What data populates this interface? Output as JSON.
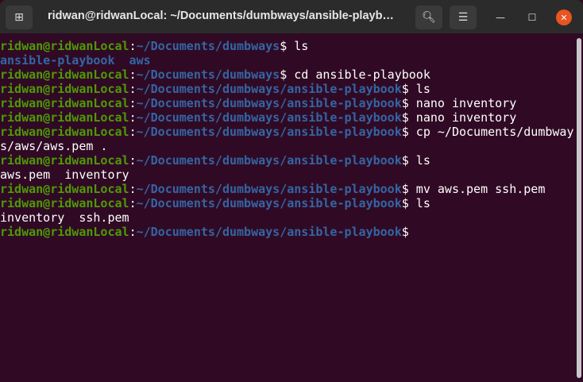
{
  "window": {
    "title": "ridwan@ridwanLocal: ~/Documents/dumbways/ansible-playb…",
    "new_tab_icon": "new-tab-icon",
    "search_icon": "search-icon",
    "menu_icon": "hamburger-menu-icon"
  },
  "terminal": {
    "colors": {
      "background": "#300a24",
      "user": "#4e9a06",
      "path": "#3465a4",
      "text": "#ffffff"
    },
    "lines": [
      {
        "user": "ridwan@ridwanLocal",
        "sep": ":",
        "path": "~/Documents/dumbways",
        "cmd": "$ ls"
      },
      {
        "dirs": "ansible-playbook  aws"
      },
      {
        "user": "ridwan@ridwanLocal",
        "sep": ":",
        "path": "~/Documents/dumbways",
        "cmd": "$ cd ansible-playbook"
      },
      {
        "user": "ridwan@ridwanLocal",
        "sep": ":",
        "path": "~/Documents/dumbways/ansible-playbook",
        "cmd": "$ ls"
      },
      {
        "user": "ridwan@ridwanLocal",
        "sep": ":",
        "path": "~/Documents/dumbways/ansible-playbook",
        "cmd": "$ nano inventory"
      },
      {
        "user": "ridwan@ridwanLocal",
        "sep": ":",
        "path": "~/Documents/dumbways/ansible-playbook",
        "cmd": "$ nano inventory"
      },
      {
        "user": "ridwan@ridwanLocal",
        "sep": ":",
        "path": "~/Documents/dumbways/ansible-playbook",
        "cmd": "$ cp ~/Documents/dumbway"
      },
      {
        "text": "s/aws/aws.pem ."
      },
      {
        "user": "ridwan@ridwanLocal",
        "sep": ":",
        "path": "~/Documents/dumbways/ansible-playbook",
        "cmd": "$ ls"
      },
      {
        "text": "aws.pem  inventory"
      },
      {
        "user": "ridwan@ridwanLocal",
        "sep": ":",
        "path": "~/Documents/dumbways/ansible-playbook",
        "cmd": "$ mv aws.pem ssh.pem"
      },
      {
        "user": "ridwan@ridwanLocal",
        "sep": ":",
        "path": "~/Documents/dumbways/ansible-playbook",
        "cmd": "$ ls"
      },
      {
        "text": "inventory  ssh.pem"
      },
      {
        "user": "ridwan@ridwanLocal",
        "sep": ":",
        "path": "~/Documents/dumbways/ansible-playbook",
        "cmd": "$"
      }
    ]
  }
}
